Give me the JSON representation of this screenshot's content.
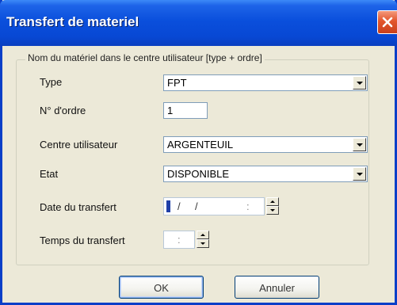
{
  "window": {
    "title": "Transfert de materiel"
  },
  "group": {
    "legend": "Nom du matériel dans le centre utilisateur [type + ordre]"
  },
  "fields": {
    "type": {
      "label": "Type",
      "value": "FPT"
    },
    "order": {
      "label": "N° d'ordre",
      "value": "1"
    },
    "centre": {
      "label": "Centre utilisateur",
      "value": "ARGENTEUIL"
    },
    "etat": {
      "label": "Etat",
      "value": "DISPONIBLE"
    },
    "date": {
      "label": "Date du transfert",
      "sep1": "/",
      "sep2": "/",
      "sep3": ":"
    },
    "time": {
      "label": "Temps du transfert",
      "sep": ":"
    }
  },
  "buttons": {
    "ok": "OK",
    "cancel": "Annuler"
  },
  "colors": {
    "titlebar": "#0a4fdc",
    "dialog_bg": "#ece9d8",
    "close": "#e2552c",
    "input_border": "#7f9db9"
  },
  "icons": {
    "close": "close-icon",
    "dropdown": "chevron-down-icon",
    "spin_up": "spin-up-icon",
    "spin_down": "spin-down-icon"
  }
}
